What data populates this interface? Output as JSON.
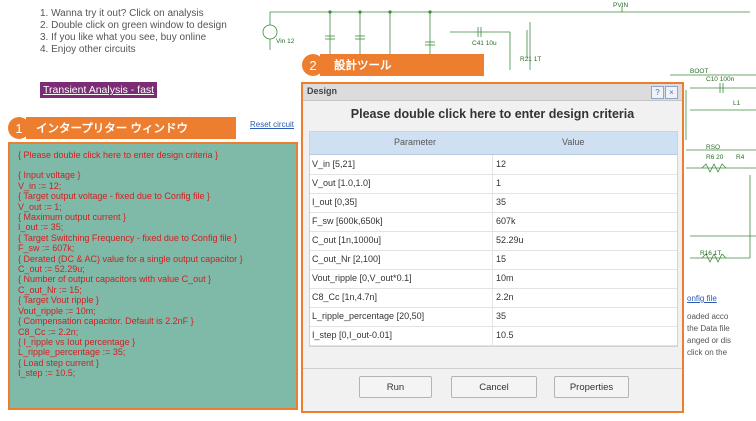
{
  "instructions": [
    "1. Wanna try it out? Click on analysis",
    "2. Double click on green window to design",
    "3. If you like what you see, buy online",
    "4. Enjoy other circuits"
  ],
  "transient_link": "Transient Analysis - fast",
  "callout1": {
    "number": "1",
    "label": "インタープリター ウィンドウ"
  },
  "callout2": {
    "number": "2",
    "label": "設計ツール"
  },
  "reset_link": "Reset circuit",
  "interpreter": {
    "lines": [
      "{ Please double click here to enter design criteria }",
      "",
      "{ Input voltage }",
      "V_in := 12;",
      "{ Target output voltage - fixed due to Config file }",
      "V_out := 1;",
      "{ Maximum output current }",
      "I_out := 35;",
      "{ Target Switching Frequency - fixed due to Config file }",
      "F_sw := 607k;",
      "{ Derated (DC & AC) value for a single output capacitor }",
      "C_out := 52.29u;",
      "{ Number of output capacitors with value C_out }",
      "C_out_Nr := 15;",
      "{ Target Vout ripple }",
      "Vout_ripple := 10m;",
      "{ Compensation capacitor.  Default is 2.2nF }",
      "C8_Cc := 2.2n;",
      "{ I_ripple vs Iout percentage }",
      "L_ripple_percentage := 35;",
      "{ Load step current }",
      "I_step := 10.5;"
    ]
  },
  "dialog": {
    "title": "Design",
    "help_icon": "?",
    "close_icon": "×",
    "header": "Please double click here to enter design criteria",
    "col_parameter": "Parameter",
    "col_value": "Value",
    "rows": [
      {
        "parameter": "V_in [5,21]",
        "value": "12"
      },
      {
        "parameter": "V_out [1.0,1.0]",
        "value": "1"
      },
      {
        "parameter": "I_out [0,35]",
        "value": "35"
      },
      {
        "parameter": "F_sw [600k,650k]",
        "value": "607k"
      },
      {
        "parameter": "C_out [1n,1000u]",
        "value": "52.29u"
      },
      {
        "parameter": "C_out_Nr [2,100]",
        "value": "15"
      },
      {
        "parameter": "Vout_ripple [0,V_out*0.1]",
        "value": "10m"
      },
      {
        "parameter": "C8_Cc [1n,4.7n]",
        "value": "2.2n"
      },
      {
        "parameter": "L_ripple_percentage [20,50]",
        "value": "35"
      },
      {
        "parameter": "I_step [0,I_out-0.01]",
        "value": "10.5"
      }
    ],
    "buttons": {
      "run": "Run",
      "cancel": "Cancel",
      "properties": "Properties"
    }
  },
  "schematic": {
    "labels": {
      "pvin": "PVIN",
      "vin": "Vin 12",
      "c41": "C41 10u",
      "r21": "R21 1T",
      "boot": "BOOT",
      "c10": "C10 100n",
      "l1": "L1",
      "rso": "RSO",
      "r6": "R6 20",
      "r16": "R16 1T",
      "r4": "R4"
    }
  },
  "config_link": "onfig file",
  "config_text": [
    "oaded acco",
    "the Data file",
    "anged or dis",
    "click on the"
  ],
  "colors": {
    "accent": "#ee7e2f",
    "interpreter_bg": "#7fb9a8",
    "interpreter_text": "#d22020",
    "link_bg": "#7b2c74",
    "table_header": "#cfe0f2"
  }
}
